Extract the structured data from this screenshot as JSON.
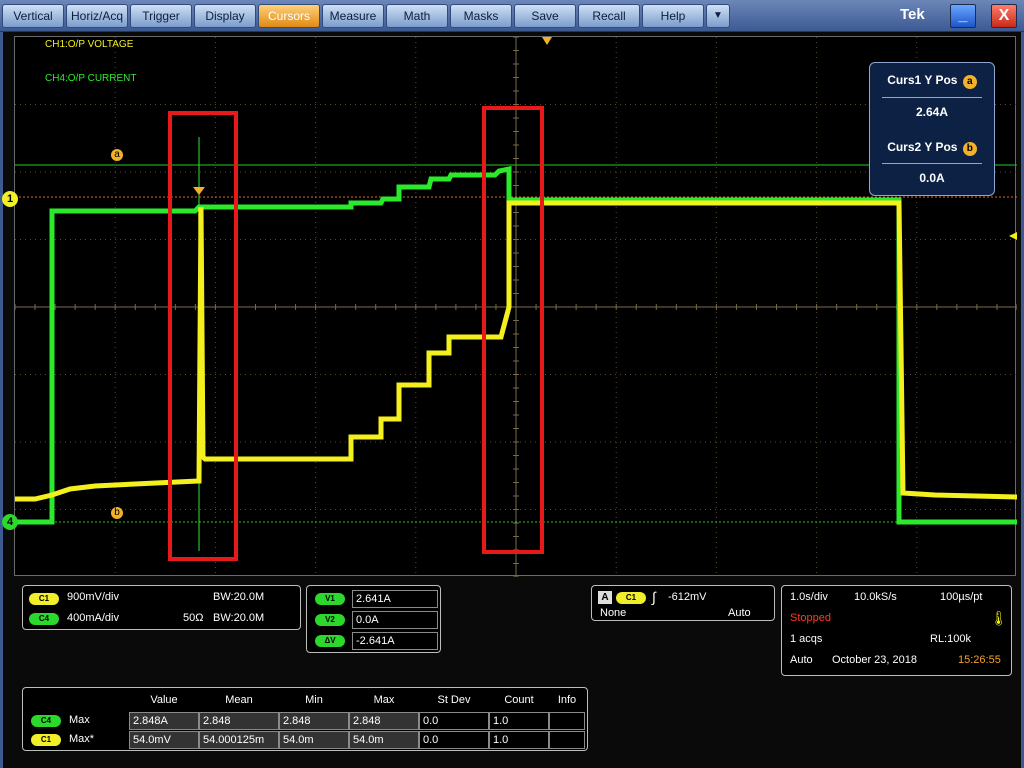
{
  "menu": {
    "items": [
      "Vertical",
      "Horiz/Acq",
      "Trigger",
      "Display",
      "Cursors",
      "Measure",
      "Math",
      "Masks",
      "Save",
      "Recall",
      "Help"
    ],
    "active": "Cursors",
    "overflow_glyph": "▼",
    "brand": "Tek",
    "minimize_glyph": "_",
    "close_glyph": "X"
  },
  "screen": {
    "ch1_label": "CH1:O/P  VOLTAGE",
    "ch4_label": "CH4:O/P CURRENT",
    "cursor_a_label": "a",
    "cursor_b_label": "b",
    "ch1_marker": "1",
    "ch4_marker": "4"
  },
  "cursor_readout": {
    "curs1_label": "Curs1 Y Pos",
    "curs1_badge": "a",
    "curs1_value": "2.64A",
    "curs2_label": "Curs2 Y Pos",
    "curs2_badge": "b",
    "curs2_value": "0.0A"
  },
  "channels": {
    "c1_badge": "C1",
    "c1_scale": "900mV/div",
    "c1_bw": "BW:20.0M",
    "c4_badge": "C4",
    "c4_scale": "400mA/div",
    "c4_impedance": "50Ω",
    "c4_bw": "BW:20.0M"
  },
  "cursor_values": {
    "v1_label": "V1",
    "v1_value": "2.641A",
    "v2_label": "V2",
    "v2_value": "0.0A",
    "dv_label": "ΔV",
    "dv_value": "-2.641A"
  },
  "trigger": {
    "source_label": "A",
    "source_badge": "C1",
    "level": "-612mV",
    "coupling": "None",
    "mode": "Auto"
  },
  "acquisition": {
    "time_div": "1.0s/div",
    "sample_rate": "10.0kS/s",
    "resolution": "100µs/pt",
    "state": "Stopped",
    "acqs": "1 acqs",
    "record_length": "RL:100k",
    "mode": "Auto",
    "date": "October 23, 2018",
    "time": "15:26:55"
  },
  "measurements": {
    "headers": [
      "Value",
      "Mean",
      "Min",
      "Max",
      "St Dev",
      "Count",
      "Info"
    ],
    "rows": [
      {
        "badge": "C4",
        "name": "Max",
        "cells": [
          "2.848A",
          "2.848",
          "2.848",
          "2.848",
          "0.0",
          "1.0",
          ""
        ]
      },
      {
        "badge": "C1",
        "name": "Max*",
        "cells": [
          "54.0mV",
          "54.000125m",
          "54.0m",
          "54.0m",
          "0.0",
          "1.0",
          ""
        ]
      }
    ]
  },
  "colors": {
    "ch1": "#f4f01e",
    "ch4": "#2bea2b",
    "cursor": "#f1b12a",
    "highlight_box": "#e81919"
  }
}
